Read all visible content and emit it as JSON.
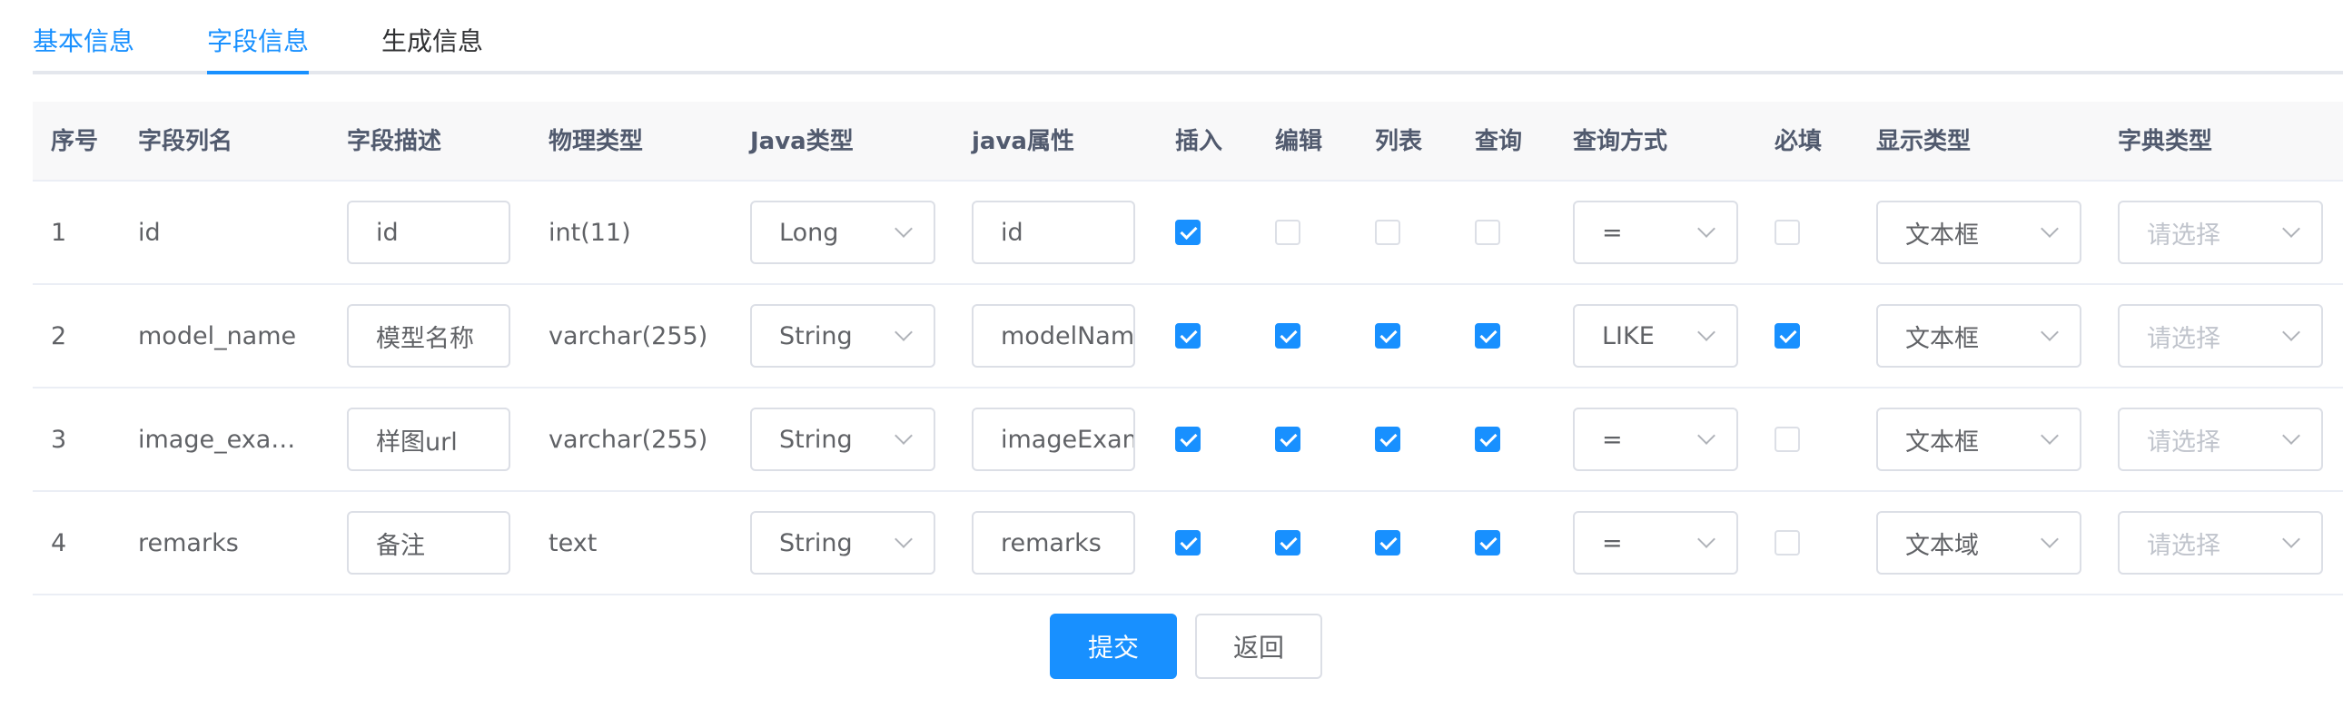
{
  "tabs": [
    {
      "label": "基本信息"
    },
    {
      "label": "字段信息"
    },
    {
      "label": "生成信息"
    }
  ],
  "columns": [
    "序号",
    "字段列名",
    "字段描述",
    "物理类型",
    "Java类型",
    "java属性",
    "插入",
    "编辑",
    "列表",
    "查询",
    "查询方式",
    "必填",
    "显示类型",
    "字典类型"
  ],
  "rows": [
    {
      "index": "1",
      "column_name": "id",
      "desc": "id",
      "physical_type": "int(11)",
      "java_type": "Long",
      "java_prop": "id",
      "insert": true,
      "edit": false,
      "list": false,
      "query": false,
      "query_type": "=",
      "required": false,
      "display_type": "文本框",
      "dict_type": "请选择"
    },
    {
      "index": "2",
      "column_name": "model_name",
      "desc": "模型名称",
      "physical_type": "varchar(255)",
      "java_type": "String",
      "java_prop": "modelName",
      "insert": true,
      "edit": true,
      "list": true,
      "query": true,
      "query_type": "LIKE",
      "required": true,
      "display_type": "文本框",
      "dict_type": "请选择"
    },
    {
      "index": "3",
      "column_name": "image_exa…",
      "desc": "样图url",
      "physical_type": "varchar(255)",
      "java_type": "String",
      "java_prop": "imageExample",
      "insert": true,
      "edit": true,
      "list": true,
      "query": true,
      "query_type": "=",
      "required": false,
      "display_type": "文本框",
      "dict_type": "请选择"
    },
    {
      "index": "4",
      "column_name": "remarks",
      "desc": "备注",
      "physical_type": "text",
      "java_type": "String",
      "java_prop": "remarks",
      "insert": true,
      "edit": true,
      "list": true,
      "query": true,
      "query_type": "=",
      "required": false,
      "display_type": "文本域",
      "dict_type": "请选择"
    }
  ],
  "buttons": {
    "submit": "提交",
    "back": "返回"
  },
  "colors": {
    "primary": "#1890ff",
    "border": "#dcdfe6",
    "header_bg": "#f8f8f9"
  }
}
